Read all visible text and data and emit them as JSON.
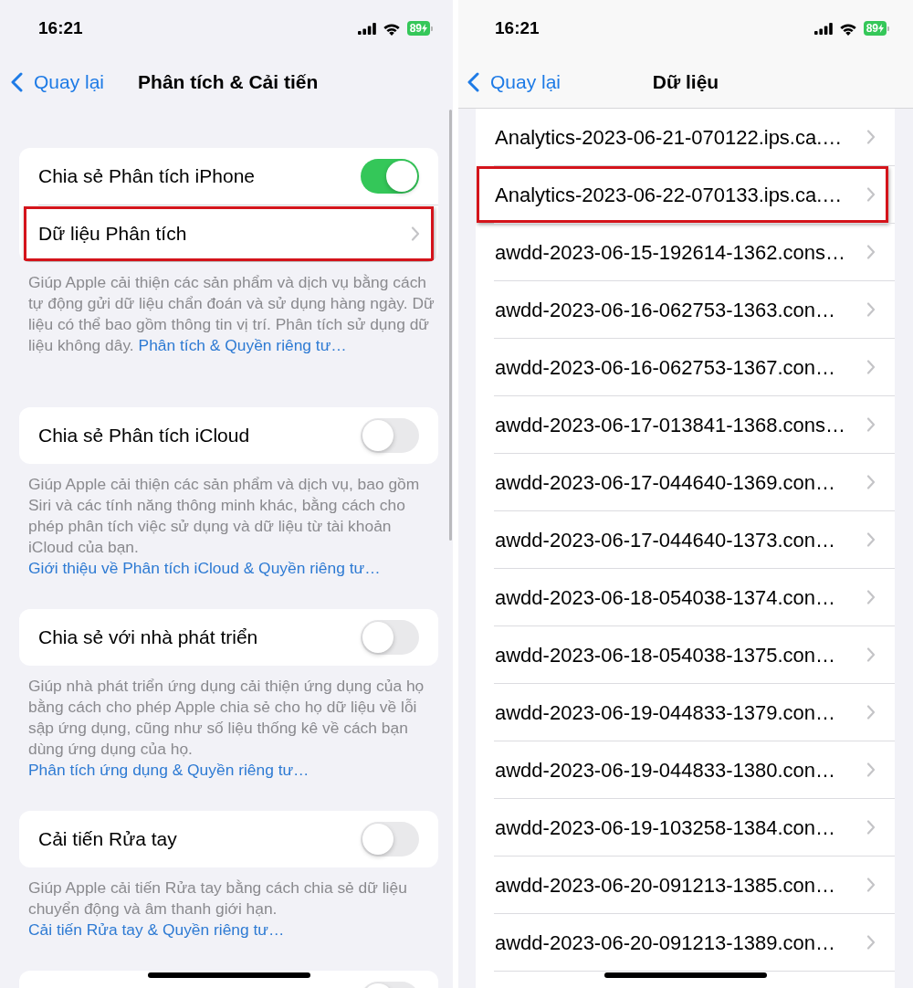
{
  "settings_screen": {
    "status_bar": {
      "time": "16:21",
      "battery": "89"
    },
    "nav": {
      "back": "Quay lại",
      "title": "Phân tích & Cải tiến"
    },
    "sections": [
      {
        "rows": [
          {
            "kind": "toggle",
            "label": "Chia sẻ Phân tích iPhone",
            "on": true
          },
          {
            "kind": "link",
            "label": "Dữ liệu Phân tích",
            "highlighted": true
          }
        ],
        "footer": {
          "text": "Giúp Apple cải thiện các sản phẩm và dịch vụ bằng cách tự động gửi dữ liệu chẩn đoán và sử dụng hàng ngày. Dữ liệu có thể bao gồm thông tin vị trí. Phân tích sử dụng dữ liệu không dây.",
          "link": "Phân tích & Quyền riêng tư…"
        }
      },
      {
        "rows": [
          {
            "kind": "toggle",
            "label": "Chia sẻ Phân tích iCloud",
            "on": false
          }
        ],
        "footer": {
          "text": "Giúp Apple cải thiện các sản phẩm và dịch vụ, bao gồm Siri và các tính năng thông minh khác, bằng cách cho phép phân tích việc sử dụng và dữ liệu từ tài khoản iCloud của bạn.",
          "link": "Giới thiệu về Phân tích iCloud & Quyền riêng tư…"
        }
      },
      {
        "rows": [
          {
            "kind": "toggle",
            "label": "Chia sẻ với nhà phát triển",
            "on": false
          }
        ],
        "footer": {
          "text": "Giúp nhà phát triển ứng dụng cải thiện ứng dụng của họ bằng cách cho phép Apple chia sẻ cho họ dữ liệu về lỗi sập ứng dụng, cũng như số liệu thống kê về cách bạn dùng ứng dụng của họ.",
          "link": "Phân tích ứng dụng & Quyền riêng tư…"
        }
      },
      {
        "rows": [
          {
            "kind": "toggle",
            "label": "Cải tiến Rửa tay",
            "on": false
          }
        ],
        "footer": {
          "text": "Giúp Apple cải tiến Rửa tay bằng cách chia sẻ dữ liệu chuyển động và âm thanh giới hạn.",
          "link": "Cải tiến Rửa tay & Quyền riêng tư…"
        }
      },
      {
        "rows": [
          {
            "kind": "toggle",
            "on": false
          }
        ]
      }
    ]
  },
  "data_screen": {
    "status_bar": {
      "time": "16:21",
      "battery": "89"
    },
    "nav": {
      "back": "Quay lại",
      "title": "Dữ liệu"
    },
    "files": [
      {
        "label": "Analytics-2023-06-21-070122.ips.ca.…",
        "highlighted": false
      },
      {
        "label": "Analytics-2023-06-22-070133.ips.ca.…",
        "highlighted": true
      },
      {
        "label": "awdd-2023-06-15-192614-1362.cons…",
        "highlighted": false
      },
      {
        "label": "awdd-2023-06-16-062753-1363.con…",
        "highlighted": false
      },
      {
        "label": "awdd-2023-06-16-062753-1367.con…",
        "highlighted": false
      },
      {
        "label": "awdd-2023-06-17-013841-1368.cons…",
        "highlighted": false
      },
      {
        "label": "awdd-2023-06-17-044640-1369.con…",
        "highlighted": false
      },
      {
        "label": "awdd-2023-06-17-044640-1373.con…",
        "highlighted": false
      },
      {
        "label": "awdd-2023-06-18-054038-1374.con…",
        "highlighted": false
      },
      {
        "label": "awdd-2023-06-18-054038-1375.con…",
        "highlighted": false
      },
      {
        "label": "awdd-2023-06-19-044833-1379.con…",
        "highlighted": false
      },
      {
        "label": "awdd-2023-06-19-044833-1380.con…",
        "highlighted": false
      },
      {
        "label": "awdd-2023-06-19-103258-1384.con…",
        "highlighted": false
      },
      {
        "label": "awdd-2023-06-20-091213-1385.con…",
        "highlighted": false
      },
      {
        "label": "awdd-2023-06-20-091213-1389.con…",
        "highlighted": false
      }
    ]
  }
}
